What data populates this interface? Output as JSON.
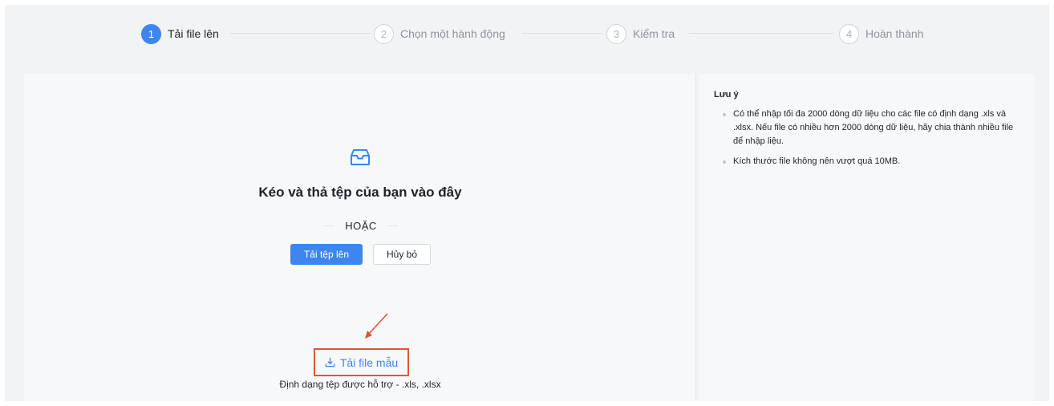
{
  "stepper": {
    "steps": [
      {
        "number": "1",
        "label": "Tải file lên",
        "active": true
      },
      {
        "number": "2",
        "label": "Chọn một hành động",
        "active": false
      },
      {
        "number": "3",
        "label": "Kiểm tra",
        "active": false
      },
      {
        "number": "4",
        "label": "Hoàn thành",
        "active": false
      }
    ]
  },
  "upload": {
    "icon": "inbox-icon",
    "title": "Kéo và thả tệp của bạn vào đây",
    "or_text": "HOẶC",
    "upload_button": "Tải tệp lên",
    "cancel_button": "Hủy bỏ",
    "download_icon": "download-icon",
    "download_template": "Tải file mẫu",
    "supported_formats": "Định dạng tệp được hỗ trợ - .xls, .xlsx"
  },
  "notes": {
    "title": "Lưu ý",
    "items": [
      "Có thể nhập tối đa 2000 dòng dữ liệu cho các file có định dạng .xls và .xlsx. Nếu file có nhiều hơn 2000 dòng dữ liệu, hãy chia thành nhiều file để nhập liệu.",
      "Kích thước file không nên vượt quá 10MB."
    ]
  },
  "colors": {
    "accent": "#3d86f0",
    "highlight": "#e2543a"
  }
}
